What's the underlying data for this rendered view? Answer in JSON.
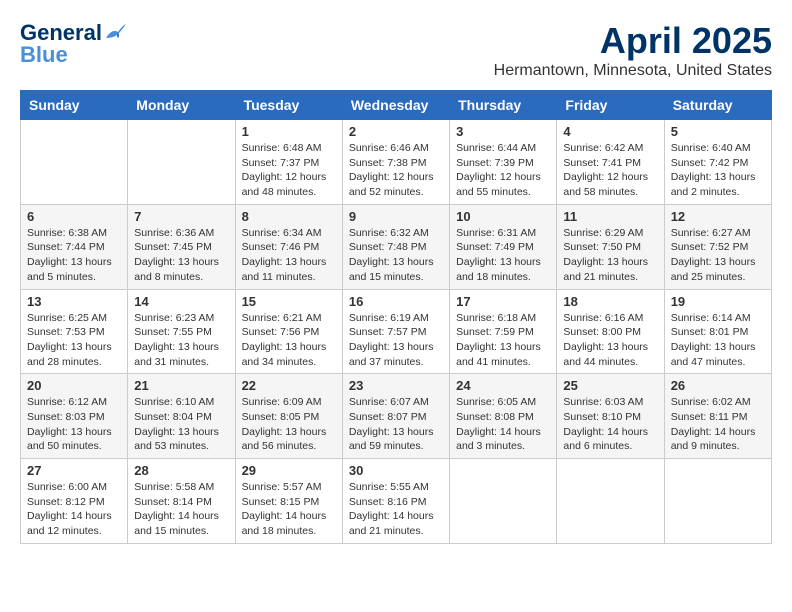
{
  "header": {
    "title": "April 2025",
    "subtitle": "Hermantown, Minnesota, United States",
    "logo_line1": "General",
    "logo_line2": "Blue"
  },
  "weekdays": [
    "Sunday",
    "Monday",
    "Tuesday",
    "Wednesday",
    "Thursday",
    "Friday",
    "Saturday"
  ],
  "rows": [
    [
      {
        "day": "",
        "info": ""
      },
      {
        "day": "",
        "info": ""
      },
      {
        "day": "1",
        "info": "Sunrise: 6:48 AM\nSunset: 7:37 PM\nDaylight: 12 hours and 48 minutes."
      },
      {
        "day": "2",
        "info": "Sunrise: 6:46 AM\nSunset: 7:38 PM\nDaylight: 12 hours and 52 minutes."
      },
      {
        "day": "3",
        "info": "Sunrise: 6:44 AM\nSunset: 7:39 PM\nDaylight: 12 hours and 55 minutes."
      },
      {
        "day": "4",
        "info": "Sunrise: 6:42 AM\nSunset: 7:41 PM\nDaylight: 12 hours and 58 minutes."
      },
      {
        "day": "5",
        "info": "Sunrise: 6:40 AM\nSunset: 7:42 PM\nDaylight: 13 hours and 2 minutes."
      }
    ],
    [
      {
        "day": "6",
        "info": "Sunrise: 6:38 AM\nSunset: 7:44 PM\nDaylight: 13 hours and 5 minutes."
      },
      {
        "day": "7",
        "info": "Sunrise: 6:36 AM\nSunset: 7:45 PM\nDaylight: 13 hours and 8 minutes."
      },
      {
        "day": "8",
        "info": "Sunrise: 6:34 AM\nSunset: 7:46 PM\nDaylight: 13 hours and 11 minutes."
      },
      {
        "day": "9",
        "info": "Sunrise: 6:32 AM\nSunset: 7:48 PM\nDaylight: 13 hours and 15 minutes."
      },
      {
        "day": "10",
        "info": "Sunrise: 6:31 AM\nSunset: 7:49 PM\nDaylight: 13 hours and 18 minutes."
      },
      {
        "day": "11",
        "info": "Sunrise: 6:29 AM\nSunset: 7:50 PM\nDaylight: 13 hours and 21 minutes."
      },
      {
        "day": "12",
        "info": "Sunrise: 6:27 AM\nSunset: 7:52 PM\nDaylight: 13 hours and 25 minutes."
      }
    ],
    [
      {
        "day": "13",
        "info": "Sunrise: 6:25 AM\nSunset: 7:53 PM\nDaylight: 13 hours and 28 minutes."
      },
      {
        "day": "14",
        "info": "Sunrise: 6:23 AM\nSunset: 7:55 PM\nDaylight: 13 hours and 31 minutes."
      },
      {
        "day": "15",
        "info": "Sunrise: 6:21 AM\nSunset: 7:56 PM\nDaylight: 13 hours and 34 minutes."
      },
      {
        "day": "16",
        "info": "Sunrise: 6:19 AM\nSunset: 7:57 PM\nDaylight: 13 hours and 37 minutes."
      },
      {
        "day": "17",
        "info": "Sunrise: 6:18 AM\nSunset: 7:59 PM\nDaylight: 13 hours and 41 minutes."
      },
      {
        "day": "18",
        "info": "Sunrise: 6:16 AM\nSunset: 8:00 PM\nDaylight: 13 hours and 44 minutes."
      },
      {
        "day": "19",
        "info": "Sunrise: 6:14 AM\nSunset: 8:01 PM\nDaylight: 13 hours and 47 minutes."
      }
    ],
    [
      {
        "day": "20",
        "info": "Sunrise: 6:12 AM\nSunset: 8:03 PM\nDaylight: 13 hours and 50 minutes."
      },
      {
        "day": "21",
        "info": "Sunrise: 6:10 AM\nSunset: 8:04 PM\nDaylight: 13 hours and 53 minutes."
      },
      {
        "day": "22",
        "info": "Sunrise: 6:09 AM\nSunset: 8:05 PM\nDaylight: 13 hours and 56 minutes."
      },
      {
        "day": "23",
        "info": "Sunrise: 6:07 AM\nSunset: 8:07 PM\nDaylight: 13 hours and 59 minutes."
      },
      {
        "day": "24",
        "info": "Sunrise: 6:05 AM\nSunset: 8:08 PM\nDaylight: 14 hours and 3 minutes."
      },
      {
        "day": "25",
        "info": "Sunrise: 6:03 AM\nSunset: 8:10 PM\nDaylight: 14 hours and 6 minutes."
      },
      {
        "day": "26",
        "info": "Sunrise: 6:02 AM\nSunset: 8:11 PM\nDaylight: 14 hours and 9 minutes."
      }
    ],
    [
      {
        "day": "27",
        "info": "Sunrise: 6:00 AM\nSunset: 8:12 PM\nDaylight: 14 hours and 12 minutes."
      },
      {
        "day": "28",
        "info": "Sunrise: 5:58 AM\nSunset: 8:14 PM\nDaylight: 14 hours and 15 minutes."
      },
      {
        "day": "29",
        "info": "Sunrise: 5:57 AM\nSunset: 8:15 PM\nDaylight: 14 hours and 18 minutes."
      },
      {
        "day": "30",
        "info": "Sunrise: 5:55 AM\nSunset: 8:16 PM\nDaylight: 14 hours and 21 minutes."
      },
      {
        "day": "",
        "info": ""
      },
      {
        "day": "",
        "info": ""
      },
      {
        "day": "",
        "info": ""
      }
    ]
  ]
}
